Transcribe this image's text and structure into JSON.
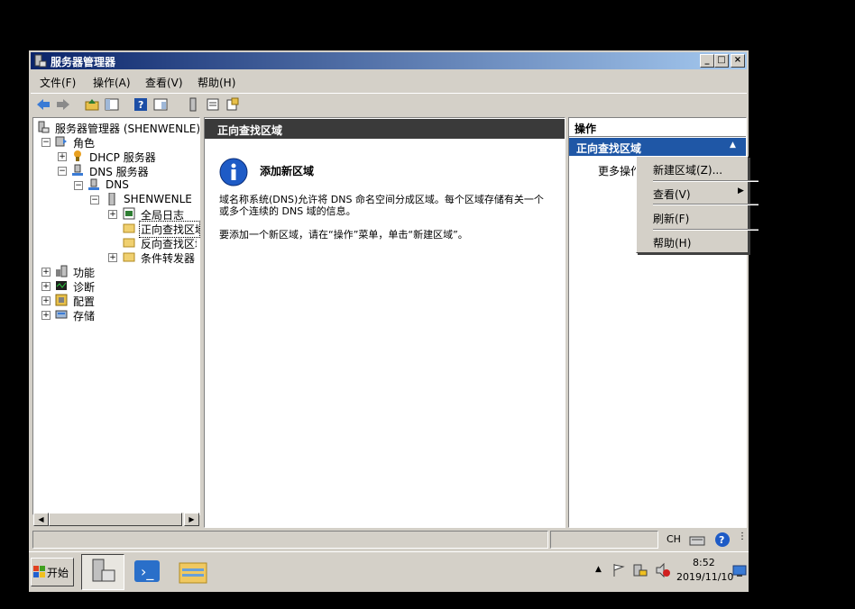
{
  "window": {
    "title": "服务器管理器",
    "min_label": "_",
    "max_label": "□",
    "close_label": "×"
  },
  "menu": [
    "文件(F)",
    "操作(A)",
    "查看(V)",
    "帮助(H)"
  ],
  "tree": {
    "root": "服务器管理器 (SHENWENLE)",
    "roles": "角色",
    "dhcp": "DHCP 服务器",
    "dns_server": "DNS 服务器",
    "dns": "DNS",
    "host": "SHENWENLE",
    "global_log": "全局日志",
    "forward_zone": "正向查找区域",
    "reverse_zone": "反向查找区域",
    "forwarders": "条件转发器",
    "features": "功能",
    "diagnostics": "诊断",
    "config": "配置",
    "storage": "存储"
  },
  "center": {
    "header": "正向查找区域",
    "info_title": "添加新区域",
    "para1": "域名称系统(DNS)允许将 DNS 命名空间分成区域。每个区域存储有关一个或多个连续的 DNS 域的信息。",
    "para2": "要添加一个新区域，请在“操作”菜单，单击“新建区域”。"
  },
  "actions": {
    "header": "操作",
    "section": "正向查找区域",
    "more": "更多操作"
  },
  "context_menu": [
    "新建区域(Z)...",
    "查看(V)",
    "刷新(F)",
    "帮助(H)"
  ],
  "statusbar": {
    "lang": "CH"
  },
  "taskbar": {
    "start": "开始",
    "time": "8:52",
    "date": "2019/11/10"
  }
}
